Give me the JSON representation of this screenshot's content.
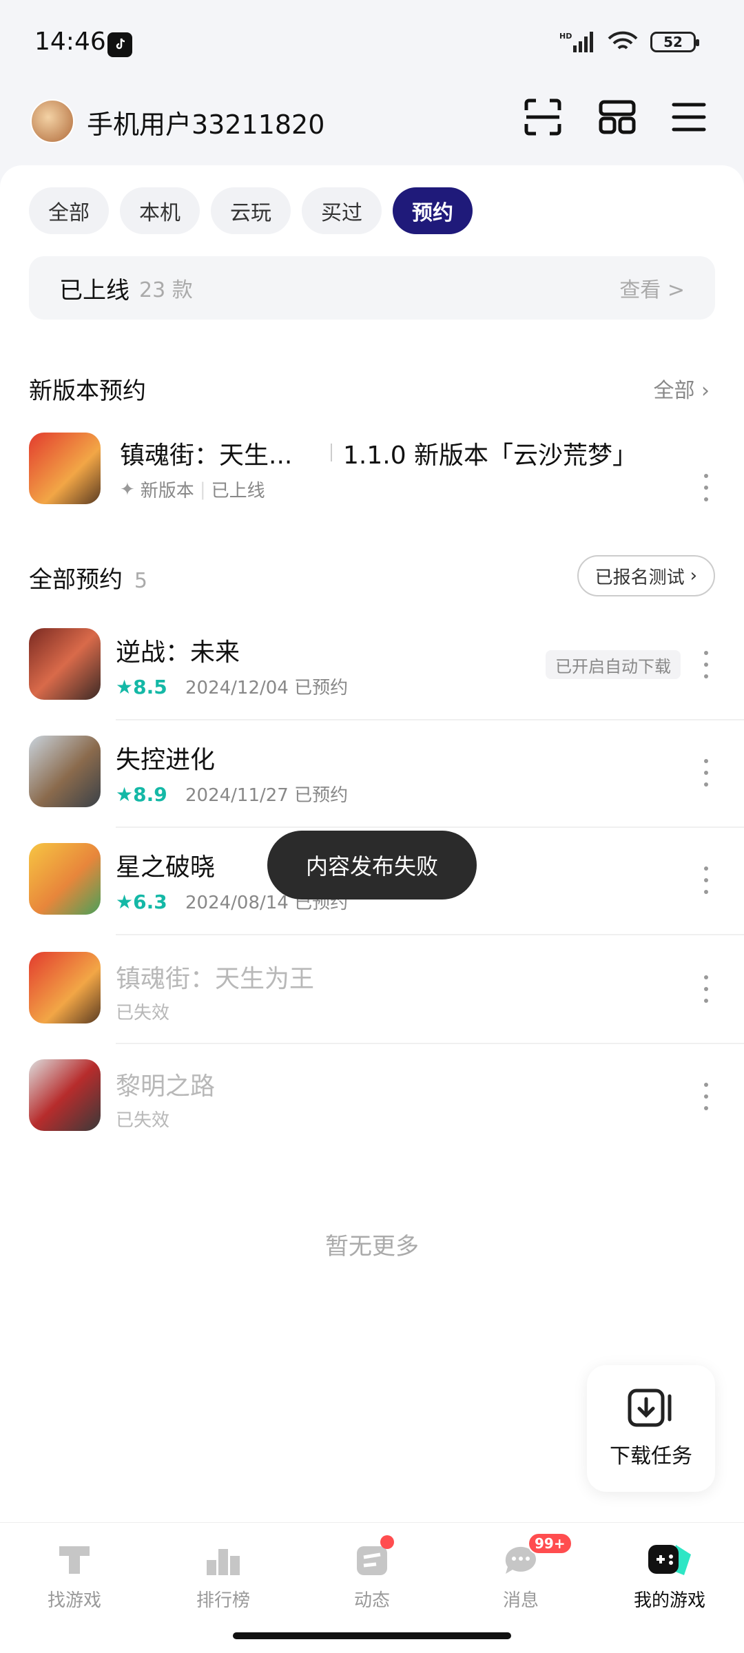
{
  "status": {
    "time": "14:46",
    "battery": "52",
    "network": "HD"
  },
  "header": {
    "username": "手机用户33211820"
  },
  "filters": [
    "全部",
    "本机",
    "云玩",
    "买过",
    "预约"
  ],
  "online": {
    "title": "已上线",
    "count": "23 款",
    "view": "查看 >"
  },
  "new_version": {
    "title": "新版本预约",
    "link": "全部",
    "item": {
      "name": "镇魂街：天生...",
      "detail": "1.1.0 新版本「云沙荒梦」",
      "tag": "新版本",
      "status": "已上线"
    }
  },
  "reservations": {
    "title": "全部预约",
    "count": "5",
    "test_button": "已报名测试",
    "items": [
      {
        "name": "逆战：未来",
        "rating": "8.5",
        "date": "2024/12/04 已预约",
        "badge": "已开启自动下载"
      },
      {
        "name": "失控进化",
        "rating": "8.9",
        "date": "2024/11/27 已预约"
      },
      {
        "name": "星之破晓",
        "rating": "6.3",
        "date": "2024/08/14 已预约"
      },
      {
        "name": "镇魂街：天生为王",
        "status": "已失效"
      },
      {
        "name": "黎明之路",
        "status": "已失效"
      }
    ]
  },
  "no_more": "暂无更多",
  "toast": "内容发布失败",
  "download_task": "下载任务",
  "tabs": [
    {
      "label": "找游戏"
    },
    {
      "label": "排行榜"
    },
    {
      "label": "动态"
    },
    {
      "label": "消息",
      "badge": "99+"
    },
    {
      "label": "我的游戏"
    }
  ],
  "colors": {
    "accent": "#1f1a7a",
    "rating": "#14b8a6",
    "badge": "#ff4d4f"
  }
}
